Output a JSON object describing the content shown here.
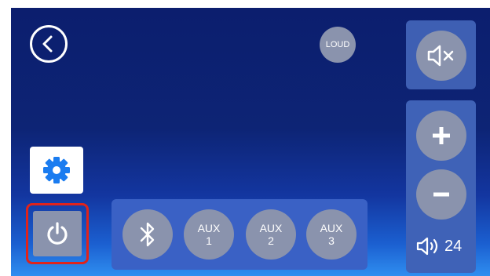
{
  "header": {
    "back_icon": "chevron-left-icon",
    "loud_label": "LOUD"
  },
  "mute": {
    "icon": "speaker-mute-icon"
  },
  "volume": {
    "up_icon": "plus-icon",
    "down_icon": "minus-icon",
    "speaker_icon": "speaker-volume-icon",
    "level": "24"
  },
  "settings": {
    "icon": "gear-icon"
  },
  "power": {
    "icon": "power-icon",
    "highlight_color": "#e0231b"
  },
  "sources": {
    "bluetooth_icon": "bluetooth-icon",
    "aux1": {
      "line1": "AUX",
      "line2": "1"
    },
    "aux2": {
      "line1": "AUX",
      "line2": "2"
    },
    "aux3": {
      "line1": "AUX",
      "line2": "3"
    }
  },
  "colors": {
    "button": "#8a93ad",
    "panel": "#3e5fb3",
    "accent": "#1a7cf0"
  }
}
